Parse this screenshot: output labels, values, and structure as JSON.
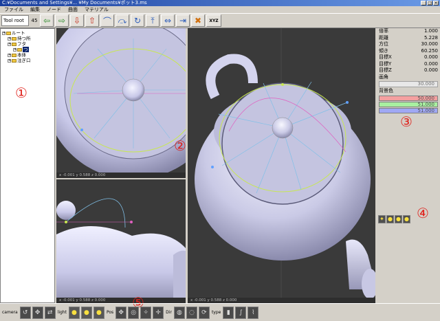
{
  "window": {
    "title": "C:¥Documents and Settings¥... ¥My Documents¥ポット3.ms",
    "buttons": [
      "_",
      "□",
      "×"
    ]
  },
  "menu": [
    "ファイル",
    "編集",
    "ノード",
    "曲面",
    "マテリアル"
  ],
  "toolbar": {
    "root_label": "Tool root",
    "root_value": "45",
    "buttons": [
      {
        "icon": "arrow-left-icon",
        "glyph": "⇦",
        "color": "g"
      },
      {
        "icon": "arrow-right-icon",
        "glyph": "⇨",
        "color": "g"
      },
      {
        "icon": "arrow-down-icon",
        "glyph": "⇩",
        "color": "r"
      },
      {
        "icon": "arrow-up-icon",
        "glyph": "⇧",
        "color": "r"
      },
      {
        "icon": "curve-icon",
        "glyph": "⌒",
        "color": "b"
      },
      {
        "icon": "curve-alt-icon",
        "glyph": "⤼",
        "color": "b"
      },
      {
        "icon": "rotate-icon",
        "glyph": "↻",
        "color": "b"
      },
      {
        "icon": "move-up-icon",
        "glyph": "⤒",
        "color": "b"
      },
      {
        "icon": "move-lr-icon",
        "glyph": "⇔",
        "color": "b"
      },
      {
        "icon": "move-right-icon",
        "glyph": "⇥",
        "color": "b"
      },
      {
        "icon": "delete-icon",
        "glyph": "✖",
        "color": "o"
      }
    ],
    "xyz_label": "XYZ"
  },
  "tree": [
    {
      "label": "ルート",
      "indent": 0,
      "selected": false
    },
    {
      "label": "持つ所",
      "indent": 1,
      "selected": false
    },
    {
      "label": "フタ",
      "indent": 1,
      "selected": false
    },
    {
      "label": "つ",
      "indent": 2,
      "selected": true
    },
    {
      "label": "本体",
      "indent": 1,
      "selected": false
    },
    {
      "label": "注ぎ口",
      "indent": 1,
      "selected": false
    }
  ],
  "viewports": {
    "top_left_status": "x -0.001 y 0.588 z 0.000",
    "bottom_left_status": "x -0.001 y 0.588 z 0.000",
    "main_status": "x -0.001 y 0.588 z 0.000"
  },
  "properties": [
    {
      "label": "倍率",
      "value": "1.000"
    },
    {
      "label": "距離",
      "value": "5.228"
    },
    {
      "label": "方位",
      "value": "30.000"
    },
    {
      "label": "傾き",
      "value": "60.250"
    },
    {
      "label": "目標X",
      "value": "0.000"
    },
    {
      "label": "目標Y",
      "value": "0.000"
    },
    {
      "label": "目標Z",
      "value": "0.000"
    },
    {
      "label": "画角",
      "value": ""
    }
  ],
  "fov_value": "30.000",
  "background_label": "背景色",
  "bg_colors": [
    {
      "value": "50.000",
      "color": "#f4a0a0"
    },
    {
      "value": "51.000",
      "color": "#a8f0a0"
    },
    {
      "value": "51.000",
      "color": "#a0a8f4"
    }
  ],
  "markers": [
    "①",
    "②",
    "③",
    "④",
    "⑤"
  ],
  "bottom": {
    "camera_label": "camera",
    "light_label": "light",
    "pos_label": "Pos",
    "dir_label": "Dir",
    "type_label": "type"
  },
  "colors": {
    "viewport_bg": "#3a3a3a",
    "marker": "#e0201a",
    "pot": "#d8d8f4"
  }
}
